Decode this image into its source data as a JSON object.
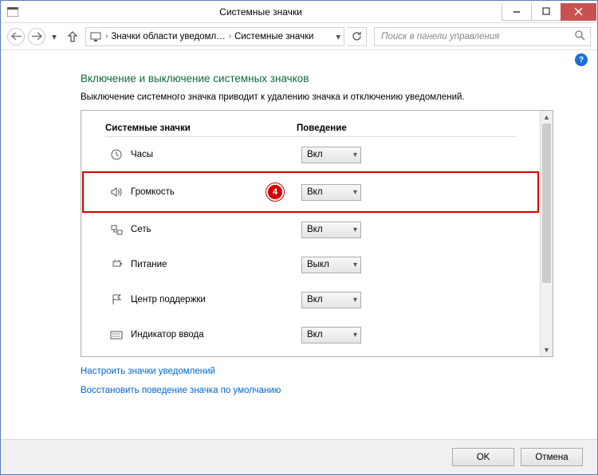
{
  "window": {
    "title": "Системные значки"
  },
  "nav": {
    "crumb1": "Значки области уведомл…",
    "crumb2": "Системные значки",
    "search_placeholder": "Поиск в панели управления"
  },
  "page": {
    "heading": "Включение и выключение системных значков",
    "description": "Выключение системного значка приводит к удалению значка и отключению уведомлений."
  },
  "table": {
    "col1": "Системные значки",
    "col2": "Поведение",
    "options": {
      "on": "Вкл",
      "off": "Выкл"
    },
    "rows": [
      {
        "icon": "clock-icon",
        "label": "Часы",
        "value": "Вкл"
      },
      {
        "icon": "volume-icon",
        "label": "Громкость",
        "value": "Вкл",
        "highlight": true,
        "badge": "4"
      },
      {
        "icon": "network-icon",
        "label": "Сеть",
        "value": "Вкл"
      },
      {
        "icon": "power-icon",
        "label": "Питание",
        "value": "Выкл"
      },
      {
        "icon": "flag-icon",
        "label": "Центр поддержки",
        "value": "Вкл"
      },
      {
        "icon": "keyboard-icon",
        "label": "Индикатор ввода",
        "value": "Вкл"
      }
    ]
  },
  "links": {
    "configure": "Настроить значки уведомлений",
    "restore": "Восстановить поведение значка по умолчанию"
  },
  "footer": {
    "ok": "OK",
    "cancel": "Отмена"
  }
}
